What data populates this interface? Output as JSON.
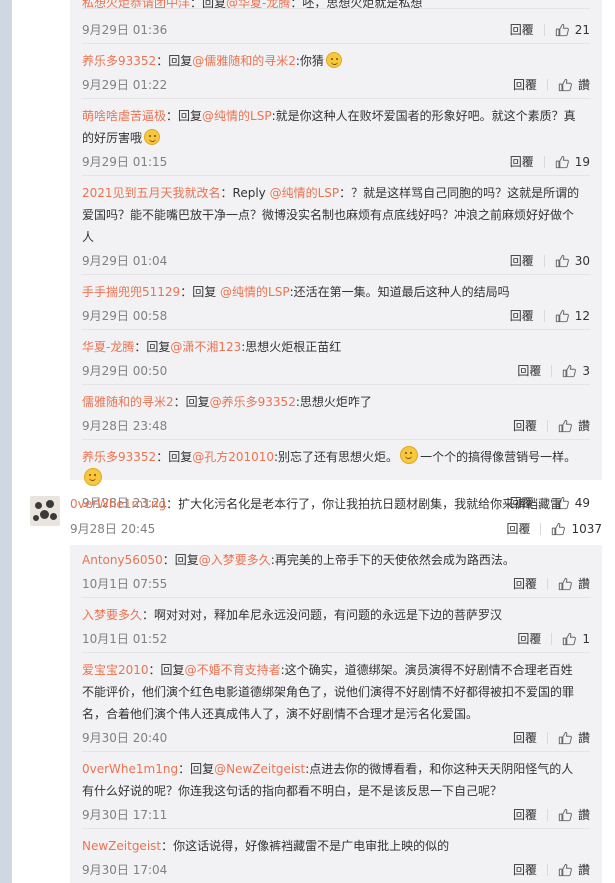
{
  "thread1": {
    "top_cropped": {
      "user": "私想火炬恭请团中洋",
      "text": "：回复",
      "at": "@华夏-龙腾",
      "rest": "：呸，思想火炬就是私想"
    },
    "replies": [
      {
        "time": "9月29日 01:36",
        "reply_label": "回覆",
        "likes": "21"
      },
      {
        "user": "养乐多93352",
        "pre": "：回复",
        "at": "@儒雅随和的寻米2",
        "text": ":你猜",
        "emoji": "smile-emoji",
        "time": "9月29日 01:22",
        "reply_label": "回覆",
        "likes": "讚"
      },
      {
        "user": "萌啥啥虐苦逼极",
        "pre": "：回复",
        "at": "@纯情的LSP",
        "text": ":就是你这种人在败坏爱国者的形象好吧。就这个素质？真的好厉害哦",
        "emoji": "shock-emoji",
        "time": "9月29日 01:15",
        "reply_label": "回覆",
        "likes": "19"
      },
      {
        "user": "2021见到五月天我就改名",
        "pre": "：Reply ",
        "at": "@纯情的LSP",
        "text": "：？就是这样骂自己同胞的吗？这就是所谓的爱国吗？能不能嘴巴放干净一点？微博没实名制也麻烦有点底线好吗？冲浪之前麻烦好好做个人",
        "time": "9月29日 01:04",
        "reply_label": "回覆",
        "likes": "30"
      },
      {
        "user": "手手揣兜兜51129",
        "pre": "：回复 ",
        "at": "@纯情的LSP",
        "text": ":还活在第一集。知道最后这种人的结局吗",
        "time": "9月29日 00:58",
        "reply_label": "回覆",
        "likes": "12"
      },
      {
        "user": "华夏-龙腾",
        "pre": "：回复",
        "at": "@潇不湘123",
        "text": ":思想火炬根正苗红",
        "time": "9月29日 00:50",
        "reply_label": "回覆",
        "likes": "3"
      },
      {
        "user": "儒雅随和的寻米2",
        "pre": "：回复",
        "at": "@养乐多93352",
        "text": ":思想火炬咋了",
        "time": "9月28日 23:48",
        "reply_label": "回覆",
        "likes": "讚"
      },
      {
        "user": "养乐多93352",
        "pre": "：回复",
        "at": "@孔方201010",
        "text": ":别忘了还有思想火炬。",
        "text2": "一个个的搞得像营销号一样。",
        "time": "9月28日 23:21",
        "reply_label": "回覆",
        "likes": "49"
      }
    ]
  },
  "main_comment": {
    "user": "0verWhe1m1ng",
    "text": "：扩大化污名化是老本行了，你让我拍抗日题材剧集，我就给你来裤裆藏雷",
    "time": "9月28日 20:45",
    "reply_label": "回覆",
    "likes": "1037"
  },
  "thread2": {
    "replies": [
      {
        "user": "Antony56050",
        "pre": "：回复",
        "at": "@入梦要多久",
        "text": ":再完美的上帝手下的天使依然会成为路西法。",
        "time": "10月1日 07:55",
        "reply_label": "回覆",
        "likes": "讚"
      },
      {
        "user": "入梦要多久",
        "pre": "：啊对对对，释加牟尼永远没问题，有问题的永远是下边的菩萨罗汉",
        "time": "10月1日 01:52",
        "reply_label": "回覆",
        "likes": "1"
      },
      {
        "user": "爱宝宝2010",
        "pre": "：回复",
        "at": "@不婚不育支持者",
        "text": ":这个确实，道德绑架。演员演得不好剧情不合理老百姓不能评价，他们演个红色电影道德绑架角色了，说他们演得不好剧情不好都得被扣不爱国的罪名，合着他们演个伟人还真成伟人了，演不好剧情不合理才是污名化爱国。",
        "time": "9月30日 20:40",
        "reply_label": "回覆",
        "likes": "讚"
      },
      {
        "user": "0verWhe1m1ng",
        "pre": "：回复",
        "at": "@NewZeitgeist",
        "text": ":点进去你的微博看看，和你这种天天阴阳怪气的人有什么好说的呢？你连我这句话的指向都看不明白，是不是该反思一下自己呢？",
        "time": "9月30日 17:11",
        "reply_label": "回覆",
        "likes": "讚"
      },
      {
        "user": "NewZeitgeist",
        "pre": "：你这话说得，好像裤裆藏雷不是广电审批上映的似的",
        "time": "9月30日 17:04",
        "reply_label": "回覆",
        "likes": "讚"
      }
    ]
  }
}
